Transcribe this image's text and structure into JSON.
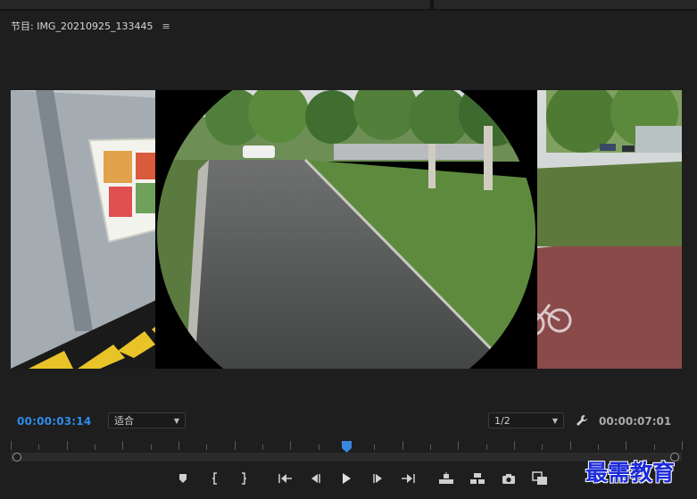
{
  "panel": {
    "title": "节目: IMG_20210925_133445",
    "menu_glyph": "≡"
  },
  "timecode": {
    "current": "00:00:03:14",
    "duration": "00:00:07:01"
  },
  "fit_select": {
    "value": "适合"
  },
  "resolution_select": {
    "value": "1/2"
  },
  "playhead": {
    "position_fraction": 0.5
  },
  "transport": {
    "buttons": [
      "add-marker",
      "mark-in",
      "mark-out",
      "go-to-in",
      "step-back",
      "play",
      "step-forward",
      "go-to-out",
      "lift",
      "extract",
      "export-frame",
      "comparison-view"
    ]
  },
  "watermark": {
    "text": "最需教育"
  },
  "colors": {
    "accent": "#2d8ceb",
    "background": "#1e1e1e"
  }
}
